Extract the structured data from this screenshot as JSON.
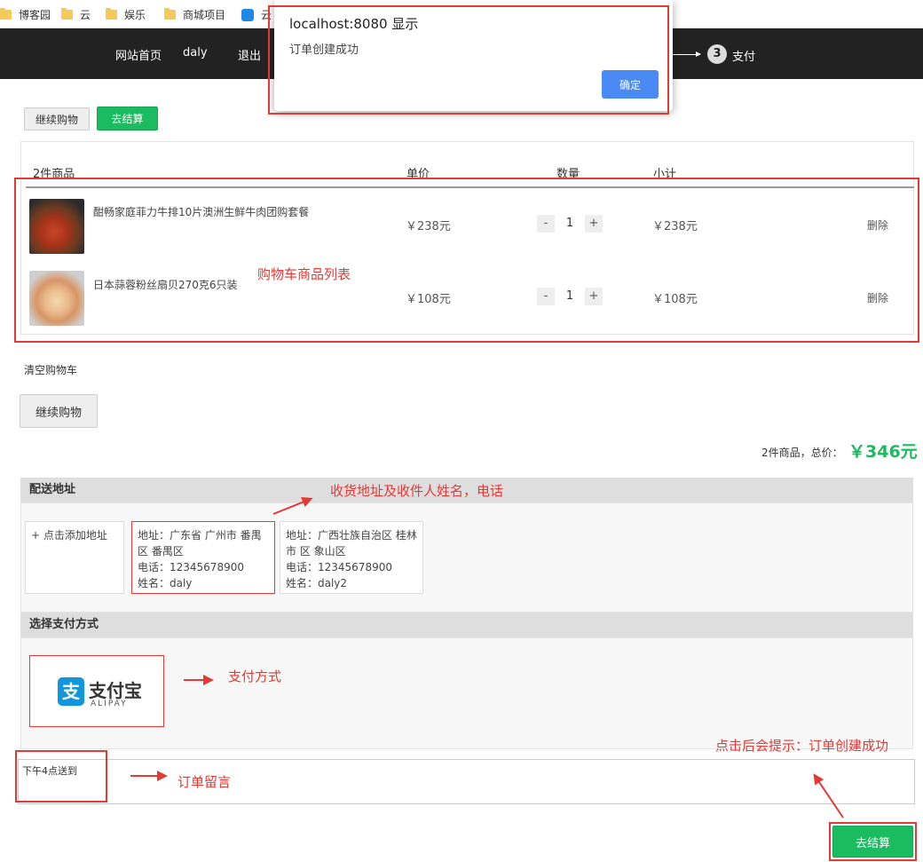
{
  "bookmarks": [
    "博客园",
    "云",
    "娱乐",
    "商城项目",
    "云"
  ],
  "nav": {
    "home": "网站首页",
    "user": "daly",
    "logout": "退出",
    "step_number": "3",
    "step_label": "支付"
  },
  "dialog": {
    "title": "localhost:8080 显示",
    "message": "订单创建成功",
    "ok": "确定"
  },
  "toolbar": {
    "continue": "继续购物",
    "checkout": "去结算"
  },
  "cart": {
    "header_count": "2件商品",
    "col_price": "单价",
    "col_qty": "数量",
    "col_subtotal": "小计",
    "items": [
      {
        "name": "酣畅家庭菲力牛排10片澳洲生鲜牛肉团购套餐",
        "price": "￥238元",
        "qty": "1",
        "subtotal": "￥238元",
        "delete": "删除"
      },
      {
        "name": "日本蒜蓉粉丝扇贝270克6只装",
        "price": "￥108元",
        "qty": "1",
        "subtotal": "￥108元",
        "delete": "删除"
      }
    ],
    "clear": "清空购物车",
    "continue": "继续购物",
    "total_label": "2件商品，总价：",
    "total_value": "￥346元"
  },
  "delivery": {
    "title": "配送地址",
    "add": "+ 点击添加地址",
    "addresses": [
      {
        "line1": "地址：广东省 广州市 番禺",
        "line2": "区 番禺区",
        "phone": "电话：12345678900",
        "name": "姓名：daly"
      },
      {
        "line1": "地址：广西壮族自治区 桂林",
        "line2": "市 区 象山区",
        "phone": "电话：12345678900",
        "name": "姓名：daly2"
      }
    ]
  },
  "payment": {
    "title": "选择支付方式",
    "alipay_cn": "支付宝",
    "alipay_en": "ALIPAY"
  },
  "order_note": {
    "value": "下午4点送到"
  },
  "submit": "去结算",
  "annotations": {
    "cart_list": "购物车商品列表",
    "address": "收货地址及收件人姓名，电话",
    "payment": "支付方式",
    "note": "订单留言",
    "submit": "点击后会提示：订单创建成功"
  },
  "colors": {
    "accent_green": "#1bbb5f",
    "annotation_red": "#e53935",
    "dialog_button": "#4a8af4"
  }
}
